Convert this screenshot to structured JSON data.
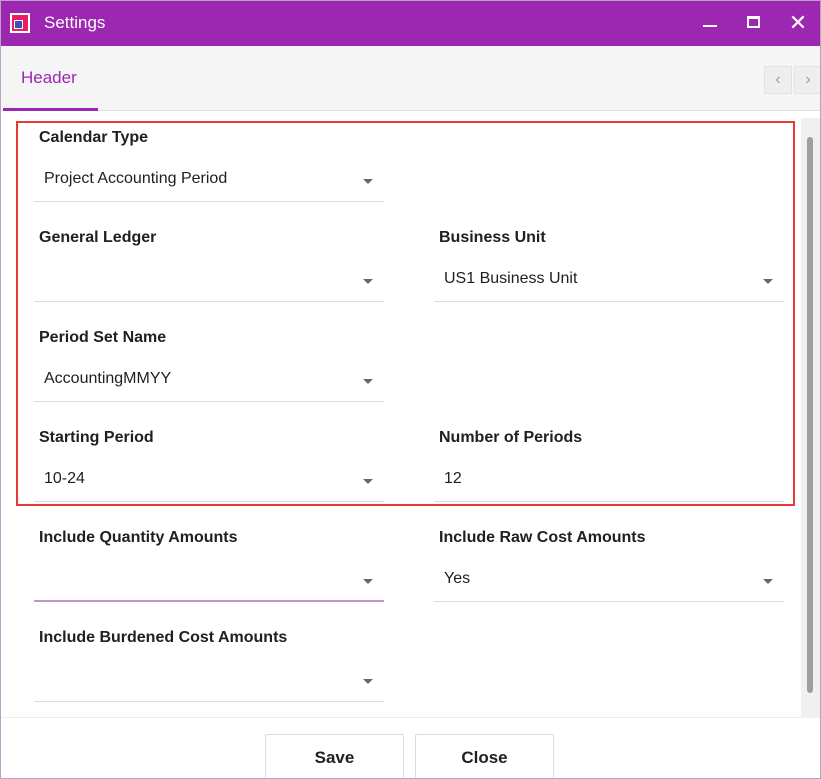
{
  "window": {
    "title": "Settings"
  },
  "tabs": [
    {
      "label": "Header",
      "active": true
    }
  ],
  "fields": {
    "calendar_type": {
      "label": "Calendar Type",
      "value": "Project Accounting Period"
    },
    "general_ledger": {
      "label": "General Ledger",
      "value": ""
    },
    "business_unit": {
      "label": "Business Unit",
      "value": "US1 Business Unit"
    },
    "period_set_name": {
      "label": "Period Set Name",
      "value": "AccountingMMYY"
    },
    "starting_period": {
      "label": "Starting Period",
      "value": "10-24"
    },
    "number_of_periods": {
      "label": "Number of Periods",
      "value": "12"
    },
    "include_quantity_amounts": {
      "label": "Include Quantity Amounts",
      "value": ""
    },
    "include_raw_cost_amounts": {
      "label": "Include Raw Cost Amounts",
      "value": "Yes"
    },
    "include_burdened_cost_amounts": {
      "label": "Include Burdened Cost Amounts",
      "value": ""
    }
  },
  "footer": {
    "save_label": "Save",
    "close_label": "Close"
  },
  "colors": {
    "accent": "#9c27b0",
    "highlight": "#e53935"
  }
}
